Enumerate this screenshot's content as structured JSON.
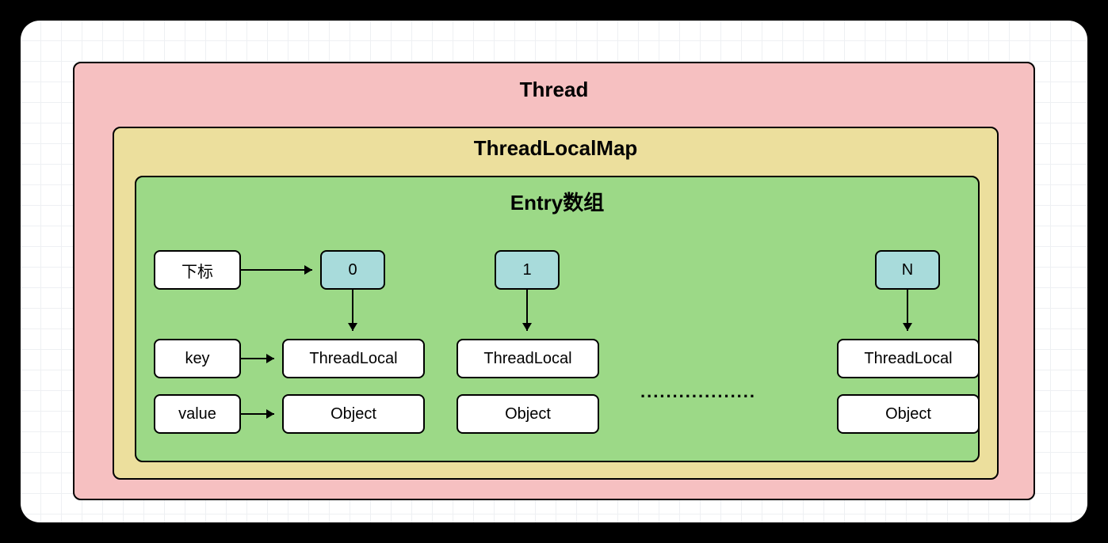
{
  "diagram": {
    "outer_title": "Thread",
    "middle_title": "ThreadLocalMap",
    "inner_title": "Entry数组",
    "labels": {
      "index": "下标",
      "key": "key",
      "value": "value"
    },
    "columns": [
      {
        "index": "0",
        "key": "ThreadLocal",
        "value": "Object"
      },
      {
        "index": "1",
        "key": "ThreadLocal",
        "value": "Object"
      },
      {
        "index": "N",
        "key": "ThreadLocal",
        "value": "Object"
      }
    ],
    "ellipsis": ".................."
  }
}
